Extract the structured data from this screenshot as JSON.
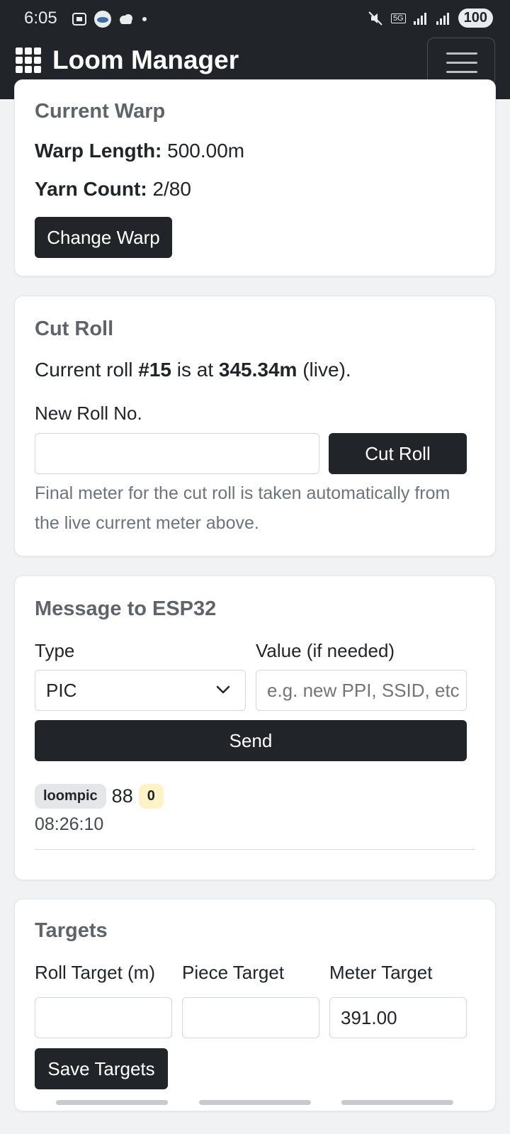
{
  "status": {
    "time": "6:05",
    "network": "5G",
    "battery": "100"
  },
  "navbar": {
    "brand": "Loom Manager"
  },
  "warp": {
    "title": "Current Warp",
    "length_label": "Warp Length:",
    "length_value": "500.00m",
    "yarn_label": "Yarn Count:",
    "yarn_value": "2/80",
    "button": "Change Warp"
  },
  "cut_roll": {
    "title": "Cut Roll",
    "text_prefix": "Current roll ",
    "roll_number": "#15",
    "text_middle": " is at ",
    "current_meter": "345.34m",
    "text_suffix": " (live).",
    "new_roll_label": "New Roll No.",
    "new_roll_value": "",
    "button": "Cut Roll",
    "help": "Final meter for the cut roll is taken automatically from the live current meter above."
  },
  "message": {
    "title": "Message to ESP32",
    "type_label": "Type",
    "type_selected": "PIC",
    "value_label": "Value (if needed)",
    "value_placeholder": "e.g. new PPI, SSID, etc",
    "button": "Send",
    "log": {
      "tag": "loompic",
      "value": "88",
      "count": "0",
      "time": "08:26:10"
    }
  },
  "targets": {
    "title": "Targets",
    "roll_label": "Roll Target (m)",
    "piece_label": "Piece Target",
    "meter_label": "Meter Target",
    "roll_value": "",
    "piece_value": "",
    "meter_value": "391.00",
    "button": "Save Targets"
  }
}
